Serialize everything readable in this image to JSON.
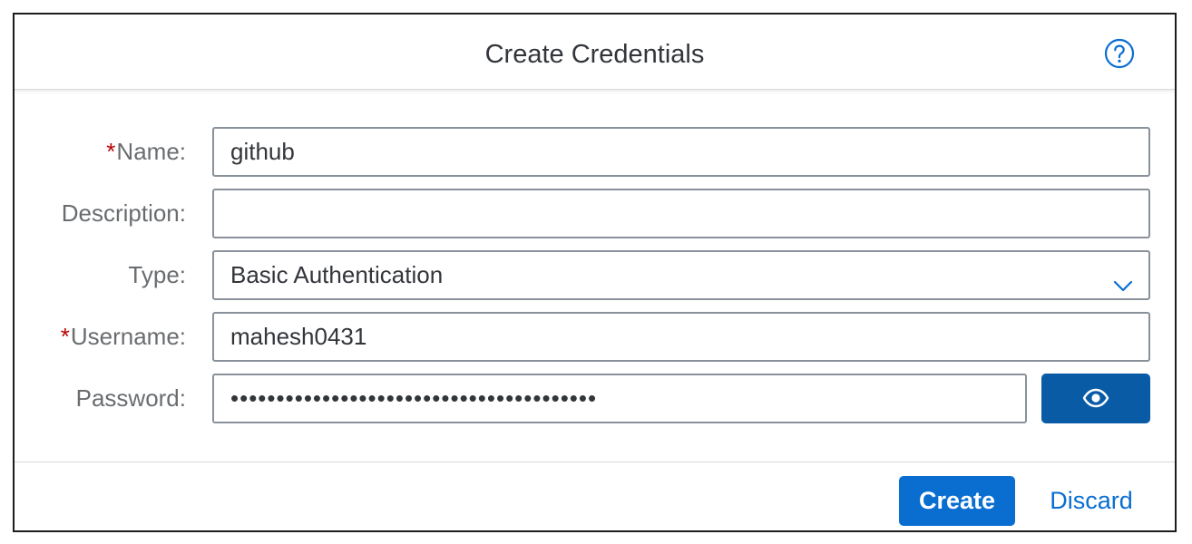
{
  "dialog": {
    "title": "Create Credentials",
    "help_icon": "help-circle-icon"
  },
  "form": {
    "name": {
      "required_mark": "*",
      "label": "Name:",
      "value": "github"
    },
    "description": {
      "label": "Description:",
      "value": ""
    },
    "type": {
      "label": "Type:",
      "selected": "Basic Authentication",
      "icon": "chevron-down-icon"
    },
    "username": {
      "required_mark": "*",
      "label": "Username:",
      "value": "mahesh0431"
    },
    "password": {
      "label": "Password:",
      "value": "••••••••••••••••••••••••••••••••••••••••",
      "toggle_icon": "eye-icon"
    }
  },
  "footer": {
    "create_label": "Create",
    "discard_label": "Discard"
  },
  "colors": {
    "primary": "#0a6ed1",
    "eye_button": "#0a5ba6",
    "required": "#bb0000",
    "label": "#6a6d70",
    "text": "#32363a",
    "field_border": "#89919a"
  }
}
